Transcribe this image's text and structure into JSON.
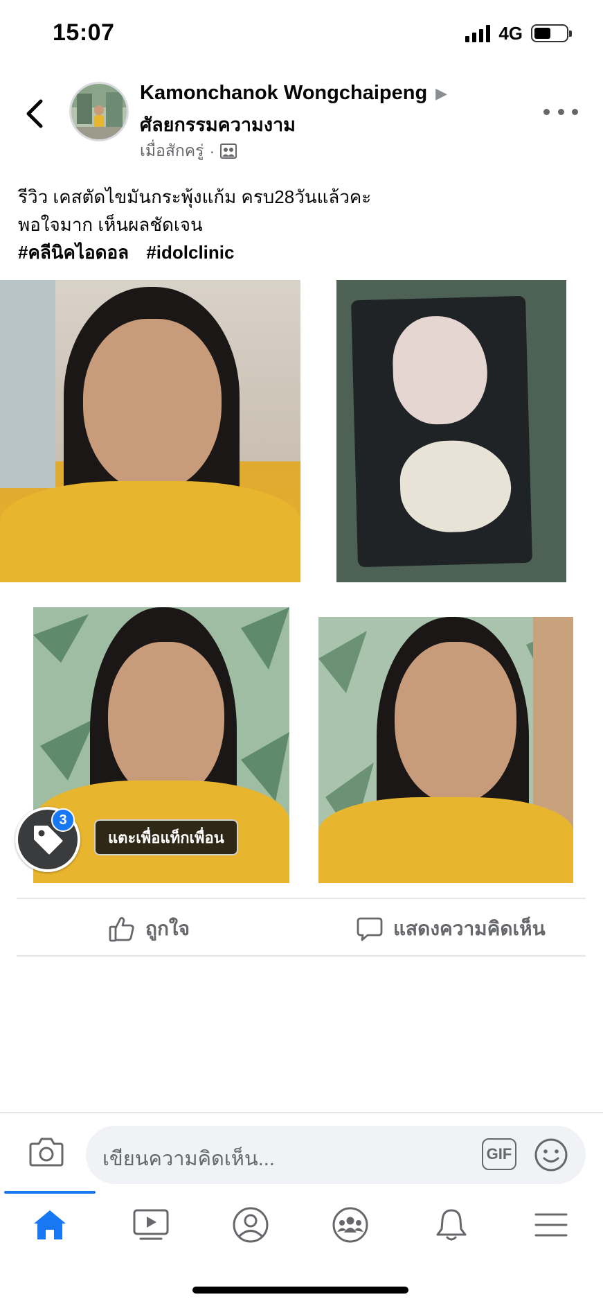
{
  "status_bar": {
    "time": "15:07",
    "network": "4G",
    "battery_level": 0.52
  },
  "post": {
    "author": "Kamonchanok Wongchaipeng",
    "group": "ศัลยกรรมความงาม",
    "timestamp": "เมื่อสักครู่",
    "meta_separator": "·",
    "body_line1": "รีวิว เคสตัดไขมันกระพุ้งแก้ม ครบ28วันแล้วคะ",
    "body_line2": "พอใจมาก เห็นผลชัดเจน",
    "hashtags": [
      "#คลีนิคไอดอล",
      "#idolclinic"
    ],
    "photo_tag_count": "3",
    "tag_tooltip": "แตะเพื่อแท็กเพื่อน"
  },
  "actions": {
    "like_label": "ถูกใจ",
    "comment_label": "แสดงความคิดเห็น"
  },
  "composer": {
    "placeholder": "เขียนความคิดเห็น...",
    "gif_label": "GIF"
  },
  "tab_bar": {
    "tabs": [
      "home-icon",
      "watch-icon",
      "profile-icon",
      "groups-icon",
      "notifications-icon",
      "menu-icon"
    ],
    "active_tab": "home-icon",
    "active_color": "#1877f2",
    "inactive_color": "#65676b"
  }
}
